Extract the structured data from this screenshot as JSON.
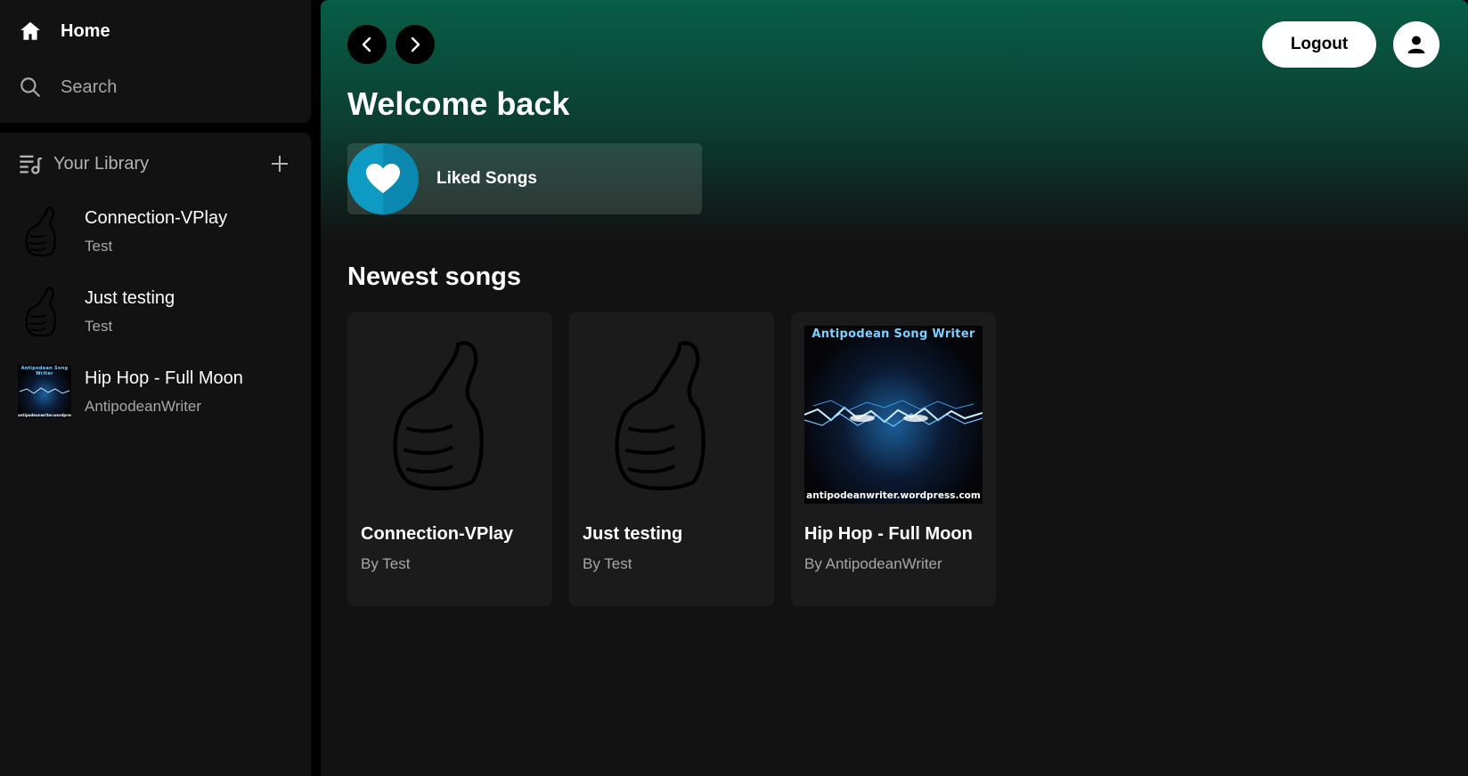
{
  "sidebar": {
    "home_label": "Home",
    "search_label": "Search",
    "library_label": "Your Library",
    "library_items": [
      {
        "title": "Connection-VPlay",
        "subtitle": "Test"
      },
      {
        "title": "Just testing",
        "subtitle": "Test"
      },
      {
        "title": "Hip Hop - Full Moon",
        "subtitle": "AntipodeanWriter"
      }
    ]
  },
  "header": {
    "logout_label": "Logout"
  },
  "main": {
    "welcome": "Welcome back",
    "liked_songs_label": "Liked Songs",
    "newest_title": "Newest songs",
    "songs": [
      {
        "title": "Connection-VPlay",
        "author": "By Test"
      },
      {
        "title": "Just testing",
        "author": "By Test"
      },
      {
        "title": "Hip Hop - Full Moon",
        "author": "By AntipodeanWriter"
      }
    ]
  },
  "cover_art": {
    "top_text": "Antipodean Song Writer",
    "bottom_text": "antipodeanwriter.wordpress.com"
  },
  "colors": {
    "gradient_top": "#075e46",
    "panel": "#121212",
    "card": "#1b1b1b",
    "liked_art": "#0d9bc4"
  }
}
